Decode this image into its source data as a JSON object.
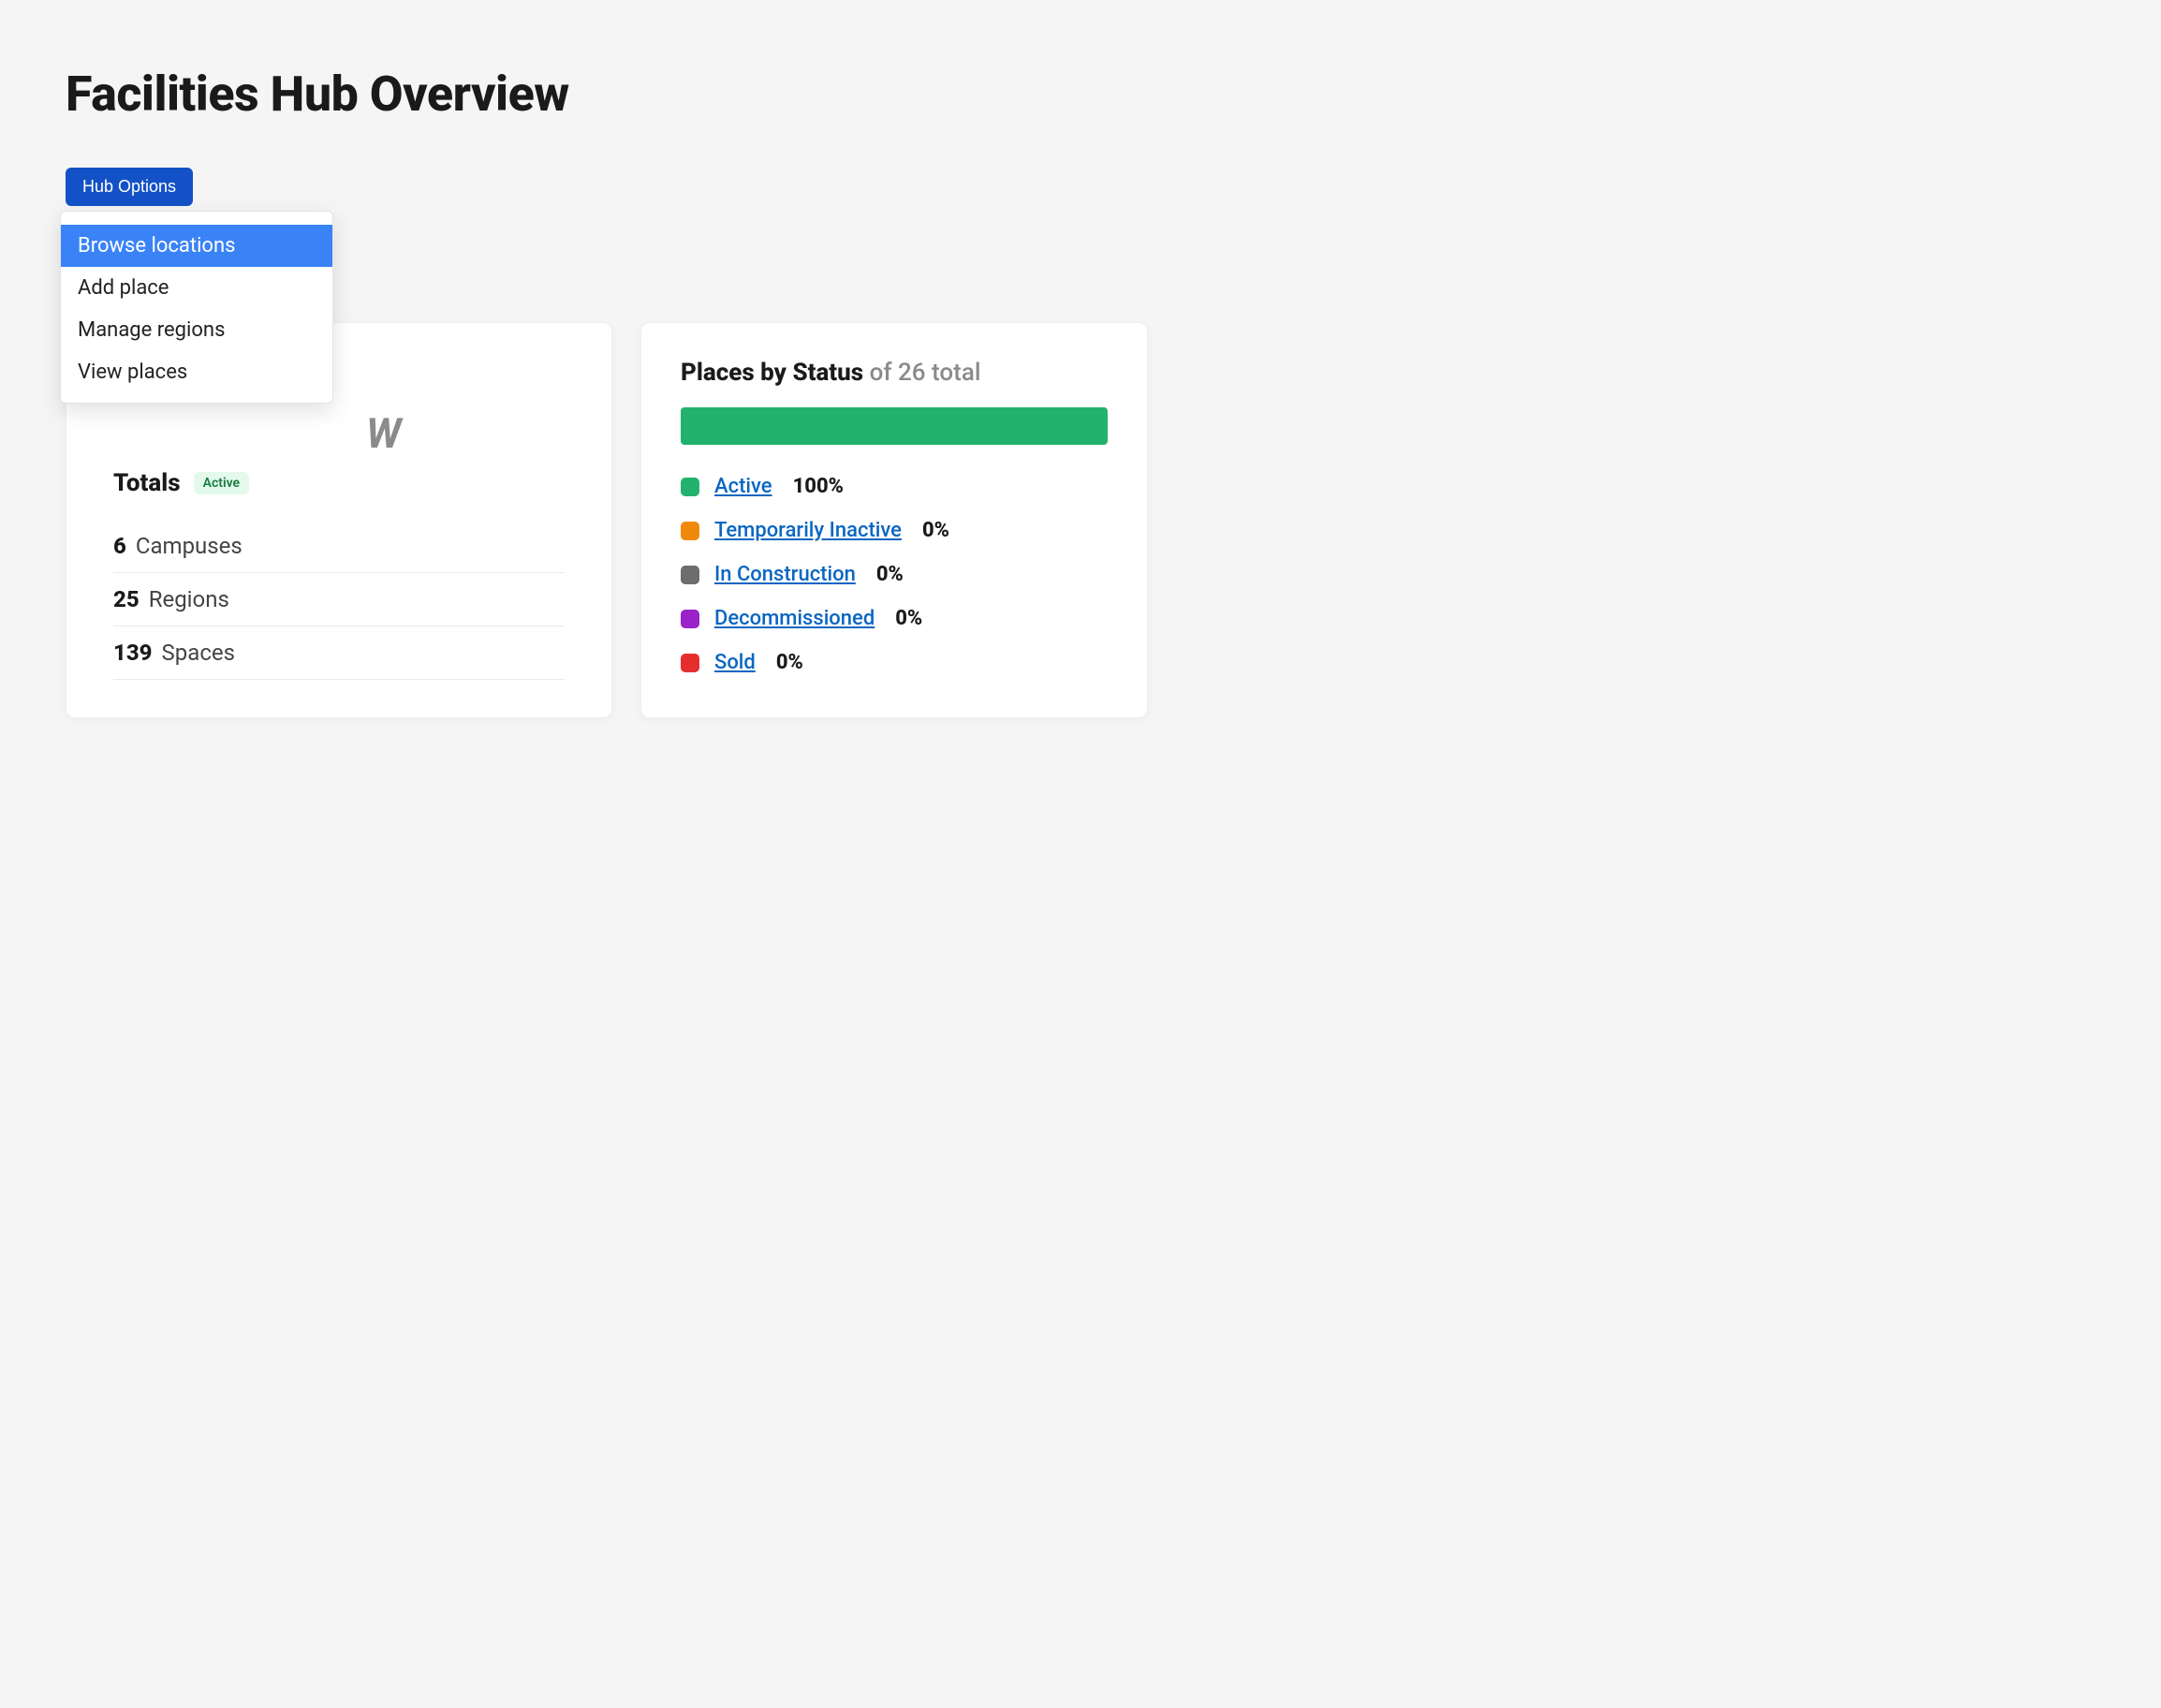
{
  "title": "Facilities Hub Overview",
  "hub_options": {
    "button_label": "Hub Options",
    "items": [
      {
        "label": "Browse locations",
        "highlight": true
      },
      {
        "label": "Add place",
        "highlight": false
      },
      {
        "label": "Manage regions",
        "highlight": false
      },
      {
        "label": "View places",
        "highlight": false
      }
    ]
  },
  "overview": {
    "ghost": "W",
    "totals_label": "Totals",
    "badge": "Active",
    "rows": [
      {
        "count": "6",
        "label": "Campuses"
      },
      {
        "count": "25",
        "label": "Regions"
      },
      {
        "count": "139",
        "label": "Spaces"
      }
    ]
  },
  "status_card": {
    "title": "Places by Status",
    "of_text": "of 26 total",
    "items": [
      {
        "label": "Active",
        "pct": "100%",
        "color": "#23b26d"
      },
      {
        "label": "Temporarily Inactive",
        "pct": "0%",
        "color": "#f0890b"
      },
      {
        "label": "In Construction",
        "pct": "0%",
        "color": "#6d6d6d"
      },
      {
        "label": "Decommissioned",
        "pct": "0%",
        "color": "#9b21c9"
      },
      {
        "label": "Sold",
        "pct": "0%",
        "color": "#e62e2e"
      }
    ]
  },
  "chart_data": {
    "type": "bar",
    "title": "Places by Status of 26 total",
    "categories": [
      "Active",
      "Temporarily Inactive",
      "In Construction",
      "Decommissioned",
      "Sold"
    ],
    "values": [
      100,
      0,
      0,
      0,
      0
    ],
    "total": 26,
    "xlabel": "",
    "ylabel": "Percent",
    "ylim": [
      0,
      100
    ]
  }
}
